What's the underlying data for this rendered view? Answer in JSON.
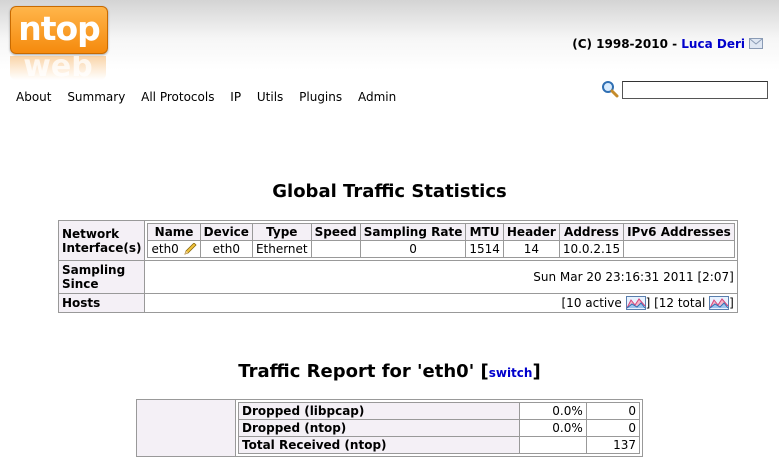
{
  "header": {
    "logo_text": "ntop",
    "logo_reflection": "web",
    "copyright_prefix": "(C) 1998-2010 - ",
    "author": "Luca Deri"
  },
  "menu": {
    "items": [
      "About",
      "Summary",
      "All Protocols",
      "IP",
      "Utils",
      "Plugins",
      "Admin"
    ]
  },
  "search": {
    "value": ""
  },
  "global": {
    "title": "Global Traffic Statistics",
    "row_labels": {
      "interfaces": "Network Interface(s)",
      "sampling_since": "Sampling Since",
      "hosts": "Hosts"
    },
    "iface_headers": [
      "Name",
      "Device",
      "Type",
      "Speed",
      "Sampling Rate",
      "MTU",
      "Header",
      "Address",
      "IPv6 Addresses"
    ],
    "iface_row": {
      "name": "eth0",
      "device": "eth0",
      "type": "Ethernet",
      "speed": "",
      "sampling_rate": "0",
      "mtu": "1514",
      "header": "14",
      "address": "10.0.2.15",
      "ipv6": ""
    },
    "sampling_since": "Sun Mar 20 23:16:31 2011 [2:07]",
    "hosts": {
      "active": "[10 active",
      "sep": "] [12 total",
      "end": "]"
    }
  },
  "report": {
    "title_prefix": "Traffic Report for 'eth0' [",
    "switch_label": "switch",
    "title_suffix": "]",
    "rows": [
      {
        "label": "Dropped (libpcap)",
        "pct": "0.0%",
        "value": "0"
      },
      {
        "label": "Dropped (ntop)",
        "pct": "0.0%",
        "value": "0"
      },
      {
        "label": "Total Received (ntop)",
        "pct": "",
        "value": "137"
      }
    ]
  },
  "colors": {
    "link": "#0000cc",
    "header_cell_bg": "#f4f0f6",
    "logo_orange": "#f58a0d"
  },
  "icons": {
    "search": "magnifier-icon",
    "mail": "mail-icon",
    "edit": "pencil-icon",
    "hosts_chart": "chart-icon"
  }
}
